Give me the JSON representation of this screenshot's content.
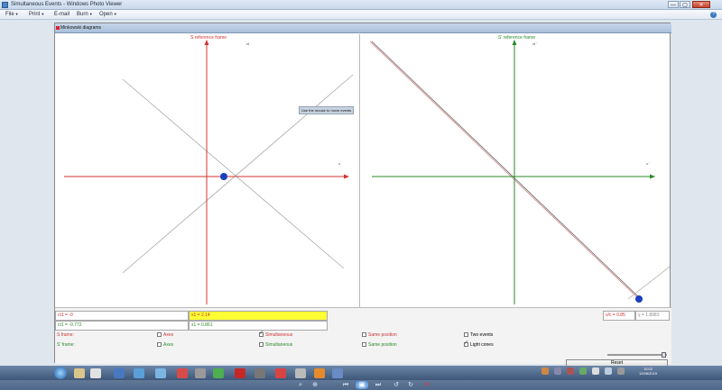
{
  "window": {
    "title": "Simultaneous Events - Windows Photo Viewer",
    "minimize": "—",
    "maximize": "▢",
    "close": "✕"
  },
  "menu": {
    "file": "File",
    "print": "Print",
    "email": "E-mail",
    "burn": "Burn",
    "open": "Open",
    "help": "?"
  },
  "dialog": {
    "title": "Minkowski diagrams"
  },
  "left_panel": {
    "title": "S reference frame",
    "y_axis_label": "ct",
    "x_axis_label": "x",
    "tooltip": "Use the mouse to move events"
  },
  "right_panel": {
    "title": "S' reference frame",
    "y_axis_label": "ct '",
    "x_axis_label": "x '"
  },
  "fields": {
    "ct1": "ct1 = -0",
    "x1": "x1 = 2.14",
    "ct1p": "ct1 = -0.772",
    "x1p": "x1 = 0.861",
    "vc": "v/c = 0.85",
    "gamma": "γ = 1.8983"
  },
  "checkboxes": {
    "s_frame": "S frame:",
    "sp_frame": "S' frame:",
    "axes1": "Axes",
    "axes2": "Axes",
    "simultaneous1": "Simultaneous",
    "simultaneous2": "Simultaneous",
    "same_position1": "Same position",
    "same_position2": "Same position",
    "two_events": "Two events",
    "light_cones": "Light cones"
  },
  "reset": "Reset",
  "clock": {
    "time": "15:02",
    "date": "12/08/2015"
  },
  "colors": {
    "s_frame": "#d43333",
    "sp_frame": "#2a8a2a",
    "event": "#1a3fbf",
    "light_cone": "#a8a8a8"
  }
}
